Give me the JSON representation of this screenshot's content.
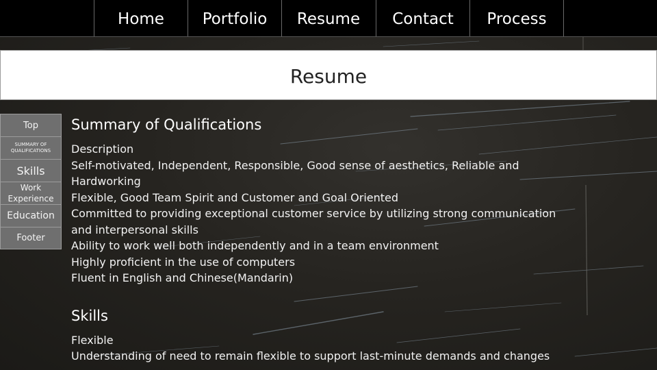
{
  "nav": {
    "items": [
      {
        "label": "Home"
      },
      {
        "label": "Portfolio"
      },
      {
        "label": "Resume"
      },
      {
        "label": "Contact"
      },
      {
        "label": "Process"
      }
    ]
  },
  "header": {
    "title": "Resume"
  },
  "sidebar": {
    "items": [
      {
        "label": "Top"
      },
      {
        "label": "SUMMARY OF QUALIFICATIONS"
      },
      {
        "label": "Skills"
      },
      {
        "label": "Work Experience"
      },
      {
        "label": "Education"
      },
      {
        "label": "Footer"
      }
    ]
  },
  "sections": {
    "summary": {
      "title": "Summary of Qualifications",
      "subheading": "Description",
      "lines": [
        "Self-motivated, Independent, Responsible, Good sense of aesthetics, Reliable and Hardworking",
        "Flexible, Good Team Spirit and Customer and Goal Oriented",
        "Committed to providing exceptional customer service by utilizing strong communication and interpersonal skills",
        "Ability to work well both independently and in a team environment",
        "Highly proficient in the use of computers",
        "Fluent in English and Chinese(Mandarin)"
      ]
    },
    "skills": {
      "title": "Skills",
      "subheading": "Flexible",
      "lines": [
        "Understanding of need to remain flexible to support last-minute demands and changes"
      ]
    }
  },
  "colors": {
    "nav_background": "#000000",
    "header_background": "#ffffff",
    "sidebar_button": "#6f6f6f",
    "page_background": "#26241f"
  }
}
